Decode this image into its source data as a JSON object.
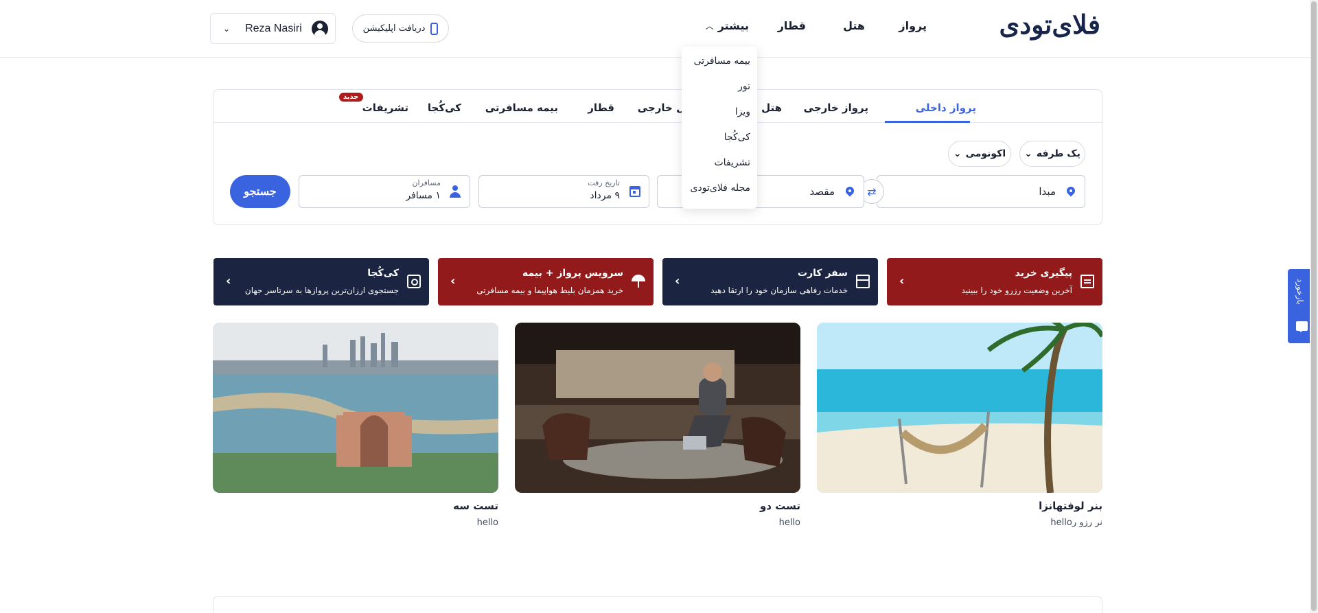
{
  "header": {
    "logo": "فلای‌تودی",
    "nav": {
      "flight": "پرواز",
      "hotel": "هتل",
      "train": "قطار",
      "more": "بیشتر"
    },
    "app_download": "دریافت اپلیکیشن",
    "user_name": "Reza Nasiri"
  },
  "more_menu": {
    "items": [
      "بیمه مسافرتی",
      "تور",
      "ویزا",
      "کی‌کُجا",
      "تشریفات",
      "مجله فلای‌تودی"
    ]
  },
  "search_panel": {
    "tabs": {
      "domestic_flight": "پرواز داخلی",
      "foreign_flight": "پرواز خارجی",
      "domestic_hotel": "هتل داخلی",
      "foreign_hotel": "هتل خارجی",
      "train": "قطار",
      "insurance": "بیمه مسافرتی",
      "kikoja": "کی‌کُجا",
      "ceremonies": "تشریفات",
      "new_badge": "جدید"
    },
    "trip_type": "یک طرفه",
    "cabin_class": "اکونومی",
    "origin_placeholder": "مبدا",
    "destination_placeholder": "مقصد",
    "date_label": "تاریخ رفت",
    "date_value": "۹ مرداد",
    "passengers_label": "مسافران",
    "passengers_value": "۱ مسافر",
    "search_button": "جستجو"
  },
  "promo_cards": [
    {
      "title": "پیگیری خرید",
      "desc": "آخرین وضعیت رزرو خود را ببینید",
      "icon": "receipt-icon",
      "color": "#931a1a"
    },
    {
      "title": "سفر کارت",
      "desc": "خدمات رفاهی سازمان خود را ارتقا دهید",
      "icon": "gift-icon",
      "color": "#1b2542"
    },
    {
      "title": "سرویس پرواز + بیمه",
      "desc": "خرید همزمان بلیط هواپیما و بیمه مسافرتی",
      "icon": "umbrella-icon",
      "color": "#931a1a"
    },
    {
      "title": "کی‌کُجا",
      "desc": "جستجوی ارزان‌ترین پروازها به سرتاسر جهان",
      "icon": "map-pin-icon",
      "color": "#1b2542"
    }
  ],
  "banners": [
    {
      "title": "بنر لوفتهانزا",
      "sub": "نر رزو رhello"
    },
    {
      "title": "تست دو",
      "sub": "hello"
    },
    {
      "title": "تست سه",
      "sub": "hello"
    }
  ],
  "feedback": "بازخورد",
  "colors": {
    "accent": "#3a63df",
    "brand_navy": "#18254a",
    "promo_red": "#931a1a",
    "promo_navy": "#1b2542"
  }
}
